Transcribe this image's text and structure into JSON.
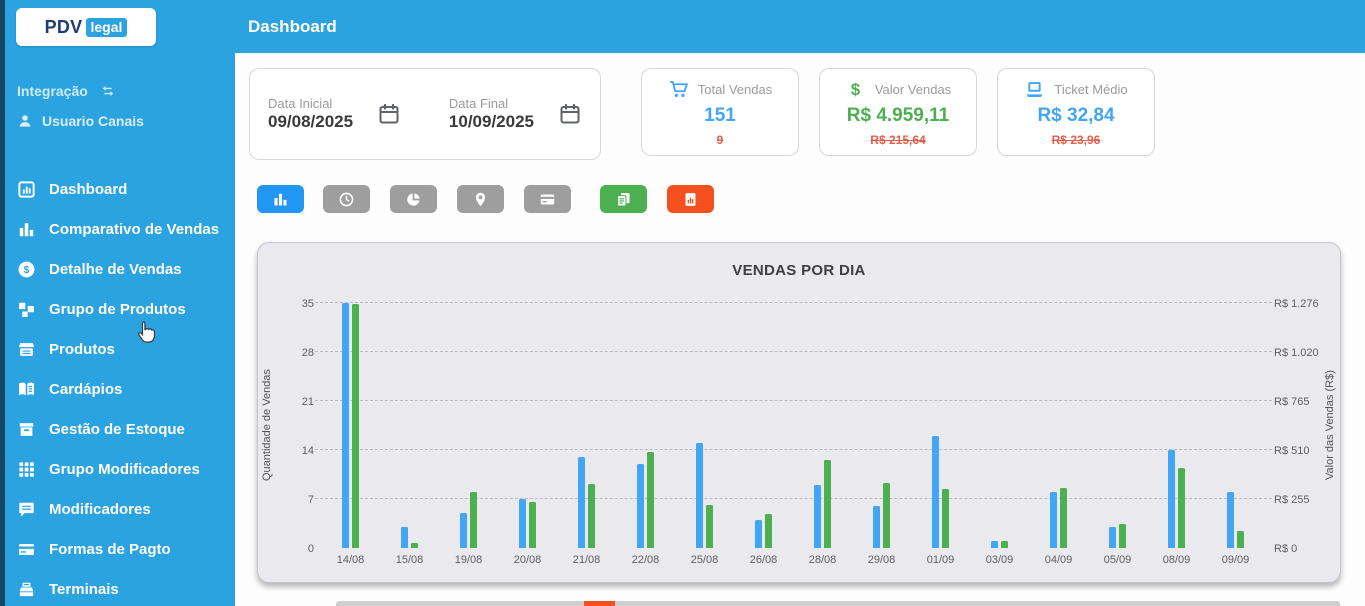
{
  "app": {
    "logo_pdv": "PDV",
    "logo_legal": "legal"
  },
  "header": {
    "title": "Dashboard"
  },
  "sidebar": {
    "section_label": "Integração",
    "section_icon": "swap-arrows-icon",
    "sub_item": {
      "icon": "user-icon",
      "label": "Usuario Canais"
    },
    "items": [
      {
        "icon": "dashboard-icon",
        "label": "Dashboard"
      },
      {
        "icon": "bar-chart-icon",
        "label": "Comparativo de Vendas"
      },
      {
        "icon": "dollar-circle-icon",
        "label": "Detalhe de Vendas"
      },
      {
        "icon": "sitemap-icon",
        "label": "Grupo de Produtos"
      },
      {
        "icon": "store-icon",
        "label": "Produtos"
      },
      {
        "icon": "menu-book-icon",
        "label": "Cardápios"
      },
      {
        "icon": "inventory-icon",
        "label": "Gestão de Estoque"
      },
      {
        "icon": "grid-icon",
        "label": "Grupo Modificadores"
      },
      {
        "icon": "comment-icon",
        "label": "Modificadores"
      },
      {
        "icon": "credit-card-icon",
        "label": "Formas de Pagto"
      },
      {
        "icon": "terminal-icon",
        "label": "Terminais"
      }
    ]
  },
  "filters": {
    "start": {
      "label": "Data Inicial",
      "value": "09/08/2025",
      "icon": "calendar-icon"
    },
    "end": {
      "label": "Data Final",
      "value": "10/09/2025",
      "icon": "calendar-icon"
    }
  },
  "stats": [
    {
      "icon": "cart-icon",
      "icon_color": "#42a5f5",
      "title": "Total Vendas",
      "value": "151",
      "previous": "9",
      "value_color": "#42a5f5"
    },
    {
      "icon": "dollar-icon",
      "icon_color": "#4caf50",
      "title": "Valor Vendas",
      "value": "R$ 4.959,11",
      "previous": "R$ 215,64",
      "value_color": "#4caf50"
    },
    {
      "icon": "ticket-icon",
      "icon_color": "#42a5f5",
      "title": "Ticket Médio",
      "value": "R$ 32,84",
      "previous": "R$ 23,96",
      "value_color": "#42a5f5"
    }
  ],
  "toolbar": [
    {
      "icon": "bar-chart-icon",
      "color": "#2196f3",
      "active": true
    },
    {
      "icon": "clock-icon",
      "color": "#9e9e9e",
      "active": false
    },
    {
      "icon": "pie-chart-icon",
      "color": "#9e9e9e",
      "active": false
    },
    {
      "icon": "location-pin-icon",
      "color": "#9e9e9e",
      "active": false
    },
    {
      "icon": "credit-card-icon",
      "color": "#9e9e9e",
      "active": false
    },
    {
      "icon": "pdf-export-icon",
      "color": "#4caf50",
      "active": false
    },
    {
      "icon": "excel-export-icon",
      "color": "#f4511e",
      "active": false
    }
  ],
  "chart_data": {
    "type": "bar",
    "title": "VENDAS POR DIA",
    "categories": [
      "14/08",
      "15/08",
      "19/08",
      "20/08",
      "21/08",
      "22/08",
      "25/08",
      "26/08",
      "28/08",
      "29/08",
      "01/09",
      "03/09",
      "04/09",
      "05/09",
      "08/09",
      "09/09"
    ],
    "series": [
      {
        "name": "Quantidade de Vendas",
        "axis": "left",
        "color": "#42a5f5",
        "values": [
          35,
          3,
          5,
          7,
          13,
          12,
          15,
          4,
          9,
          6,
          16,
          1,
          8,
          3,
          14,
          8
        ]
      },
      {
        "name": "Valor das Vendas (R$)",
        "axis": "right",
        "color": "#4caf50",
        "values": [
          1270,
          25,
          290,
          240,
          335,
          500,
          225,
          175,
          460,
          340,
          305,
          35,
          315,
          125,
          415,
          90
        ]
      }
    ],
    "left_axis": {
      "label": "Quantidade de Vendas",
      "ticks": [
        "0",
        "7",
        "14",
        "21",
        "28",
        "35"
      ],
      "max": 35
    },
    "right_axis": {
      "label": "Valor das Vendas (R$)",
      "ticks": [
        "R$ 0",
        "R$ 255",
        "R$ 510",
        "R$ 765",
        "R$ 1.020",
        "R$ 1.276"
      ],
      "max": 1276
    },
    "grid": "dashed-horizontal",
    "legend": "none"
  },
  "colors": {
    "primary_blue": "#2ba3e0",
    "active_button_blue": "#2196f3",
    "inactive_button_gray": "#9e9e9e",
    "pdf_button_green": "#4caf50",
    "excel_button_orange": "#f4511e",
    "negative_red": "#e2604e",
    "chart_bg": "#e9e9ee",
    "bar_blue": "#42a5f5",
    "bar_green": "#4caf50"
  }
}
